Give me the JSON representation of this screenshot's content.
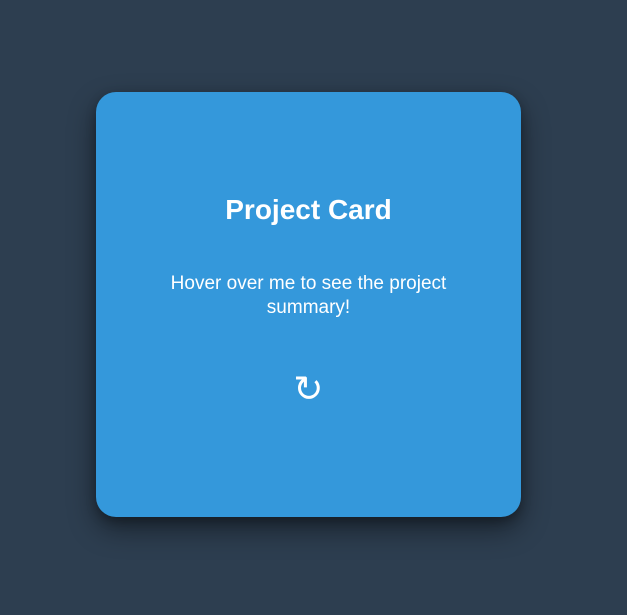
{
  "card": {
    "title": "Project Card",
    "description": "Hover over me to see the project summary!",
    "icon": "↻",
    "icon_name": "rotate-icon"
  },
  "colors": {
    "background": "#2d3e50",
    "card": "#3498db",
    "text": "#ffffff"
  }
}
